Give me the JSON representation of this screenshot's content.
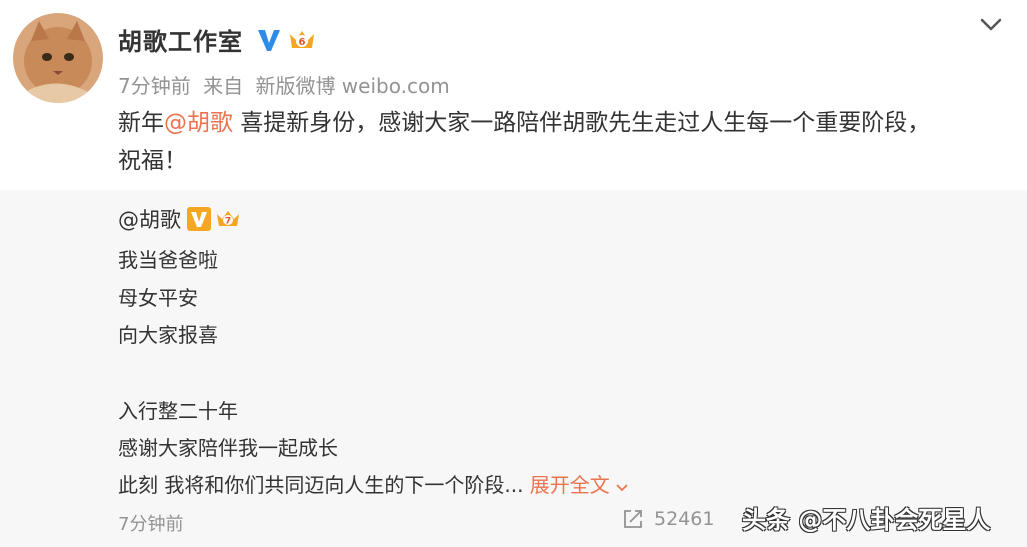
{
  "post": {
    "author": "胡歌工作室",
    "time": "7分钟前",
    "from_label": "来自",
    "client": "新版微博 weibo.com",
    "text_prefix": "新年",
    "mention": "@胡歌",
    "text_rest": " 喜提新身份，感谢大家一路陪伴胡歌先生走过人生每一个重要阶段，",
    "text_line2": "祝福！"
  },
  "repost": {
    "author": "@胡歌",
    "lines": [
      "我当爸爸啦",
      "母女平安",
      "向大家报喜",
      "入行整二十年",
      "感谢大家陪伴我一起成长",
      "此刻 我将和你们共同迈向人生的下一个阶段..."
    ],
    "expand_label": "展开全文",
    "time": "7分钟前",
    "share_count": "52461"
  },
  "watermark": "头条 @不八卦会死星人",
  "colors": {
    "accent": "#eb7350",
    "verified_blue": "#2f8be8",
    "verified_orange": "#f5a623",
    "meta_gray": "#939393"
  },
  "icons": [
    "avatar-cat",
    "verified-v-icon",
    "crown-level-icon",
    "chevron-down-icon",
    "share-icon"
  ]
}
